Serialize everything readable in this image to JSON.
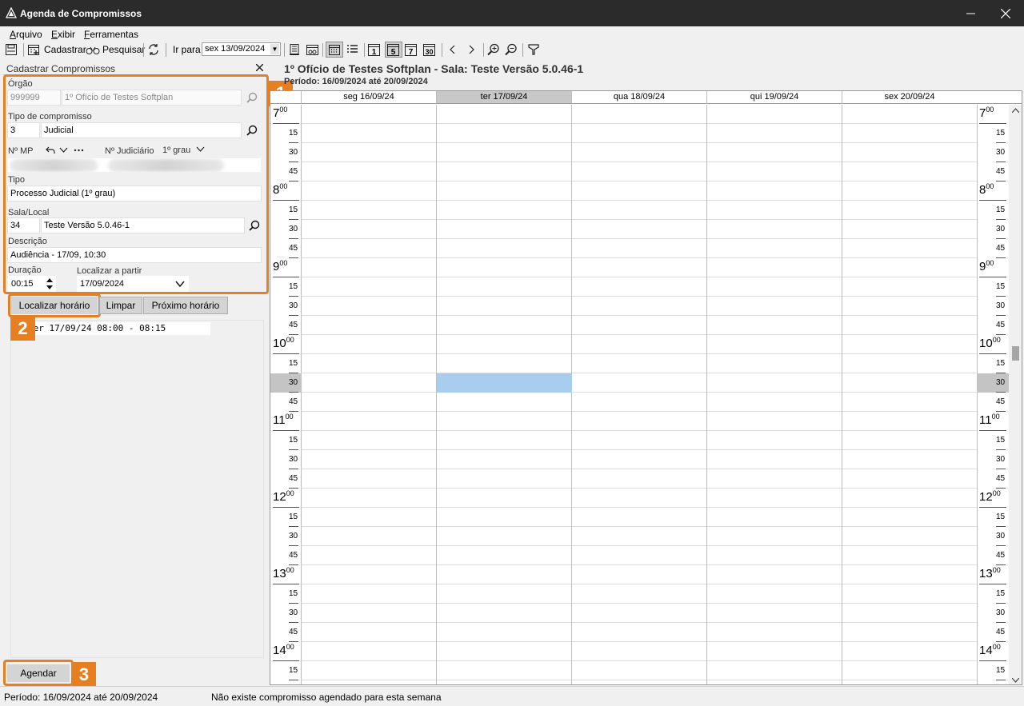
{
  "window": {
    "title": "Agenda de Compromissos"
  },
  "menu": [
    {
      "label": "Arquivo",
      "key": "A"
    },
    {
      "label": "Exibir",
      "key": "E"
    },
    {
      "label": "Ferramentas",
      "key": "F"
    }
  ],
  "toolbar": {
    "cadastrar_label": "Cadastrar",
    "pesquisar_label": "Pesquisar",
    "goto_label": "Ir para",
    "goto_value": "sex 13/09/2024",
    "day_icons": [
      "1",
      "5",
      "7",
      "30"
    ]
  },
  "panel": {
    "title": "Cadastrar Compromissos",
    "orgao_label": "Órgão",
    "orgao_code": "999999",
    "orgao_name": "1º Ofício de Testes Softplan",
    "tipo_comp_label": "Tipo de compromisso",
    "tipo_comp_code": "3",
    "tipo_comp_name": "Judicial",
    "nmp_label": "Nº MP",
    "njud_label": "Nº Judiciário",
    "grau_label": "1º grau",
    "tipo_label": "Tipo",
    "tipo_value": "Processo Judicial (1º grau)",
    "sala_label": "Sala/Local",
    "sala_code": "34",
    "sala_name": "Teste Versão 5.0.46-1",
    "descricao_label": "Descrição",
    "descricao_value": "Audiência - 17/09, 10:30",
    "duracao_label": "Duração",
    "duracao_value": "00:15",
    "localizar_partir_label": "Localizar a partir",
    "localizar_partir_value": "17/09/2024",
    "btn_localizar": "Localizar horário",
    "btn_limpar": "Limpar",
    "btn_proximo": "Próximo horário",
    "result": "ter 17/09/24 08:00 - 08:15",
    "btn_agendar": "Agendar",
    "badges": [
      "1",
      "2",
      "3"
    ]
  },
  "calendar": {
    "title": "1º Ofício de Testes Softplan - Sala: Teste Versão 5.0.46-1",
    "period": "Período: 16/09/2024 até 20/09/2024",
    "days": [
      "seg 16/09/24",
      "ter 17/09/24",
      "qua 18/09/24",
      "qui 19/09/24",
      "sex 20/09/24"
    ],
    "today_index": 1,
    "hours": [
      "7",
      "8",
      "9",
      "10",
      "11",
      "12",
      "13",
      "14"
    ],
    "minutes": [
      "00",
      "15",
      "30",
      "45"
    ],
    "selected": {
      "day_index": 1,
      "hour": "10",
      "minute": "30"
    }
  },
  "status": {
    "period": "Período: 16/09/2024 até 20/09/2024",
    "message": "Não existe compromisso agendado para esta semana"
  }
}
